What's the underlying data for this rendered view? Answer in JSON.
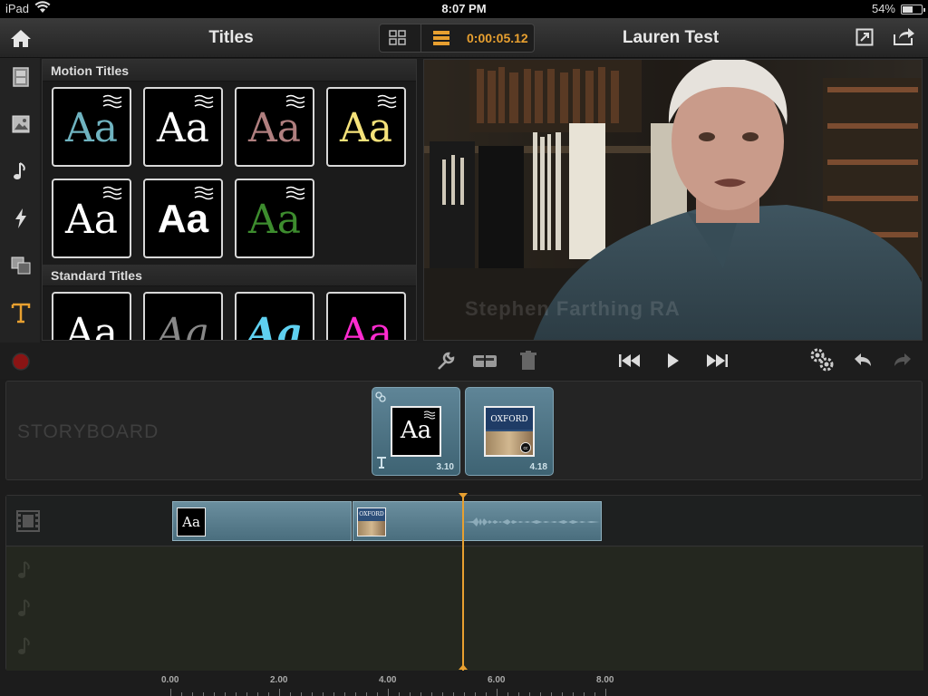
{
  "status_bar": {
    "carrier": "iPad",
    "time": "8:07 PM",
    "battery_text": "54%",
    "battery_level": 0.54
  },
  "toolbar": {
    "title": "Titles",
    "timecode": "0:00:05.12",
    "project_name": "Lauren Test"
  },
  "rail": {
    "items": [
      "film-icon",
      "photo-icon",
      "music-icon",
      "transition-icon",
      "pip-icon",
      "title-icon"
    ],
    "active": "title-icon"
  },
  "browser": {
    "motion_header": "Motion Titles",
    "standard_header": "Standard Titles",
    "motion_titles": [
      {
        "text": "Aa",
        "color": "#6fb3c0"
      },
      {
        "text": "Aa",
        "color": "#ffffff"
      },
      {
        "text": "Aa",
        "color": "#b07f7f"
      },
      {
        "text": "Aa",
        "color": "#f5e27a"
      },
      {
        "text": "Aa",
        "color": "#ffffff"
      },
      {
        "text": "Aa",
        "color": "#ffffff"
      },
      {
        "text": "Aa",
        "color": "#3d8c2e"
      }
    ],
    "standard_titles": [
      {
        "text": "Aa",
        "color": "#ffffff"
      },
      {
        "text": "Aa",
        "color": "#888888"
      },
      {
        "text": "Aa",
        "color": "#5fd0f0"
      },
      {
        "text": "Aa",
        "color": "#ff2bd0"
      }
    ]
  },
  "preview": {
    "watermark": "Stephen Farthing RA"
  },
  "storyboard": {
    "label": "STORYBOARD",
    "clips": [
      {
        "kind": "title",
        "thumb_text": "Aa",
        "duration": "3.10"
      },
      {
        "kind": "photo",
        "thumb_text": "OXFORD",
        "duration": "4.18"
      }
    ]
  },
  "timeline": {
    "ruler": [
      "0.00",
      "2.00",
      "4.00",
      "6.00",
      "8.00"
    ],
    "title_clip_text": "Aa",
    "photo_clip_text": "OXFORD"
  },
  "colors": {
    "accent": "#e8a030",
    "clip": "#5f8597"
  }
}
